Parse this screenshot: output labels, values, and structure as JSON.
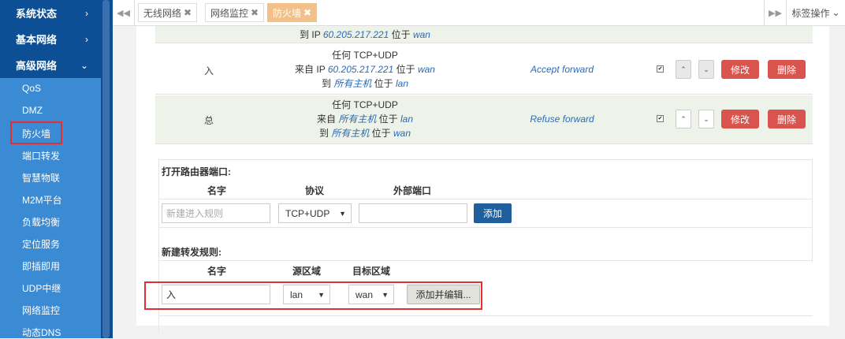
{
  "sidebar": {
    "sections": [
      {
        "label": "系统状态",
        "chevron": "›"
      },
      {
        "label": "基本网络",
        "chevron": "›"
      },
      {
        "label": "高级网络",
        "chevron": "⌄"
      }
    ],
    "items": [
      "QoS",
      "DMZ",
      "防火墙",
      "端口转发",
      "智慧物联",
      "M2M平台",
      "负载均衡",
      "定位服务",
      "即插即用",
      "UDP中继",
      "网络监控",
      "动态DNS"
    ],
    "active_item": "防火墙"
  },
  "tabbar": {
    "tabs": [
      {
        "label": "无线网络",
        "active": false
      },
      {
        "label": "网络监控",
        "active": false
      },
      {
        "label": "防火墙",
        "active": true
      }
    ],
    "close_glyph": "✖",
    "tab_ops_label": "标签操作",
    "tab_ops_caret": "⌄"
  },
  "rules": {
    "partial_row": {
      "line_prefix": "到 IP ",
      "ip": "60.205.217.221",
      "at": " 位于 ",
      "zone": "wan"
    },
    "rows": [
      {
        "direction": "入",
        "line1": "任何 TCP+UDP",
        "line2_prefix": "来自 IP ",
        "line2_src": "60.205.217.221",
        "line2_at": " 位于 ",
        "line2_zone": "wan",
        "line3_prefix": "到 ",
        "line3_dst": "所有主机",
        "line3_at": " 位于 ",
        "line3_zone": "lan",
        "action": "Accept forward",
        "enabled": true
      },
      {
        "direction": "总",
        "line1": "任何 TCP+UDP",
        "line2_prefix": "来自 ",
        "line2_src": "所有主机",
        "line2_at": " 位于 ",
        "line2_zone": "lan",
        "line3_prefix": "到 ",
        "line3_dst": "所有主机",
        "line3_at": " 位于 ",
        "line3_zone": "wan",
        "action": "Refuse forward",
        "enabled": true
      }
    ],
    "up_icon": "⌃",
    "down_icon": "⌄",
    "check_glyph": "✔",
    "edit_label": "修改",
    "delete_label": "删除"
  },
  "open_port": {
    "title": "打开路由器端口:",
    "col_name": "名字",
    "col_protocol": "协议",
    "col_ext_port": "外部端口",
    "name_placeholder": "新建进入规则",
    "protocol_value": "TCP+UDP",
    "add_label": "添加"
  },
  "new_forward": {
    "title": "新建转发规则:",
    "col_name": "名字",
    "col_src_zone": "源区域",
    "col_dst_zone": "目标区域",
    "name_value": "入",
    "src_zone_value": "lan",
    "dst_zone_value": "wan",
    "add_edit_label": "添加并编辑..."
  },
  "colors": {
    "sidebar_dark": "#0d4f94",
    "sidebar_light": "#3a8ad4",
    "delete_red": "#d9534f",
    "add_blue": "#1f5f9c",
    "highlight_red": "#e03030"
  }
}
